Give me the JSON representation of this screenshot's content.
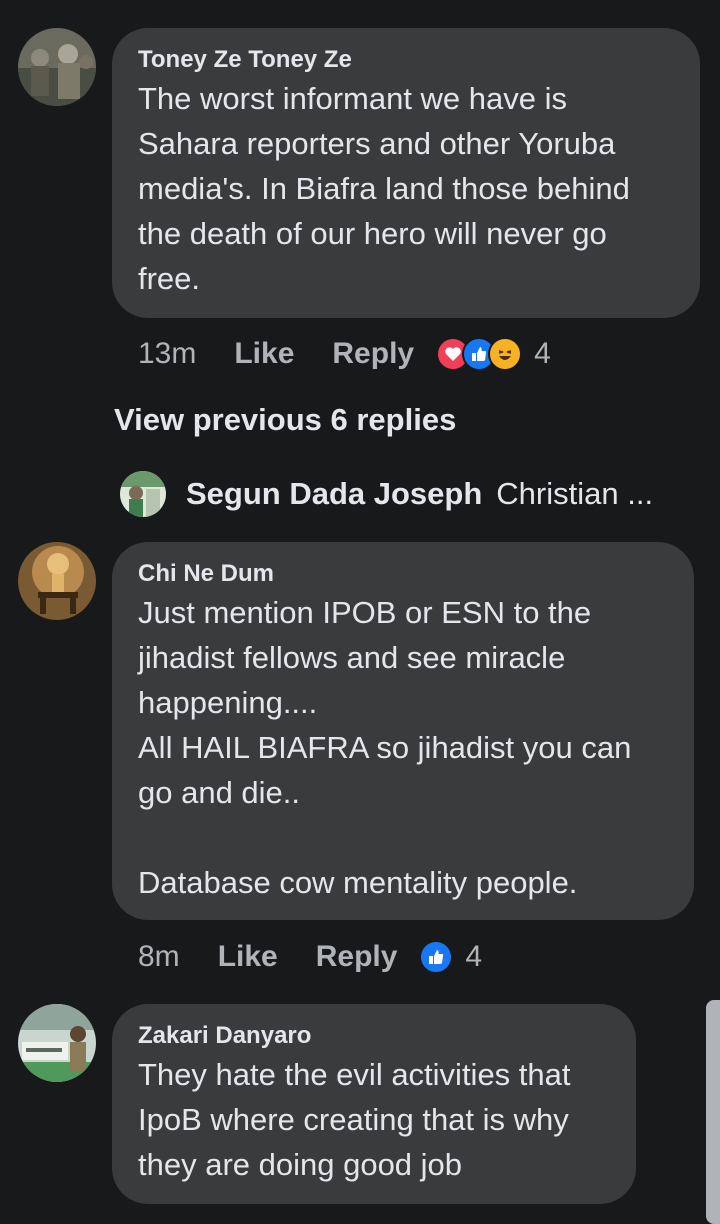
{
  "comments": [
    {
      "author": "Toney Ze Toney Ze",
      "text": "The worst informant we have is Sahara reporters and other Yoruba media's. In Biafra land those behind the death of our hero will never go free.",
      "time": "13m",
      "like_label": "Like",
      "reply_label": "Reply",
      "reactions": [
        "love-icon",
        "like-icon",
        "haha-icon"
      ],
      "reaction_count": "4"
    },
    {
      "author": "Chi Ne Dum",
      "text": "Just mention IPOB or ESN to the jihadist fellows and see miracle happening....\nAll HAIL BIAFRA so jihadist you can go and die..\n\nDatabase cow mentality people.",
      "time": "8m",
      "like_label": "Like",
      "reply_label": "Reply",
      "reactions": [
        "like-icon"
      ],
      "reaction_count": "4"
    },
    {
      "author": "Zakari Danyaro",
      "text": "They hate the evil activities that IpoB where creating that is why they are doing good job"
    }
  ],
  "view_previous": "View previous 6 replies",
  "reply_preview": {
    "author": "Segun Dada Joseph",
    "text": "Christian ..."
  },
  "colors": {
    "background": "#18191a",
    "bubble": "#3a3b3c",
    "like_blue": "#1877f2",
    "love_red": "#f33e58",
    "haha_yellow": "#f7b125"
  }
}
